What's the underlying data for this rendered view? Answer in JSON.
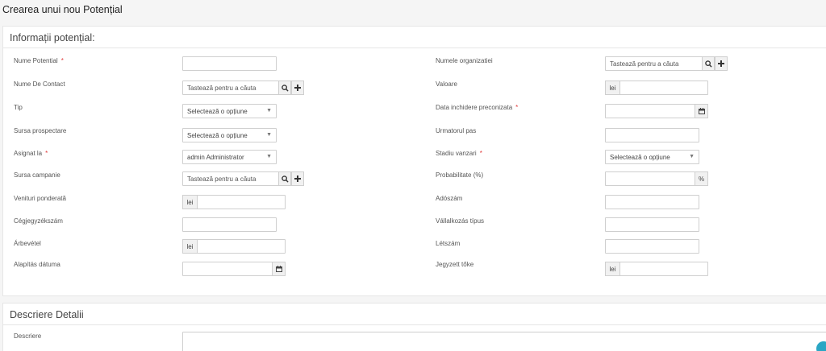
{
  "page": {
    "title": "Crearea unui nou Potențial"
  },
  "sections": {
    "info_title": "Informații potențial:",
    "desc_title": "Descriere Detalii"
  },
  "fields": {
    "nume_potential": {
      "label": "Nume Potential",
      "value": ""
    },
    "nume_contact": {
      "label": "Nume De Contact",
      "placeholder": "Tastează pentru a căuta"
    },
    "tip": {
      "label": "Tip",
      "selected": "Selectează o opțiune"
    },
    "sursa_prospectare": {
      "label": "Sursa prospectare",
      "selected": "Selectează o opțiune"
    },
    "asignat_la": {
      "label": "Asignat la",
      "selected": "admin Administrator"
    },
    "sursa_campanie": {
      "label": "Sursa campanie",
      "placeholder": "Tastează pentru a căuta"
    },
    "venituri_ponderata": {
      "label": "Venituri ponderată",
      "prefix": "lei"
    },
    "cegjegyzekszam": {
      "label": "Cégjegyzékszám"
    },
    "arbevetel": {
      "label": "Árbevétel",
      "prefix": "lei"
    },
    "alapitas_datuma": {
      "label": "Alapítás dátuma"
    },
    "numele_organizatiei": {
      "label": "Numele organizatiei",
      "placeholder": "Tastează pentru a căuta"
    },
    "valoare": {
      "label": "Valoare",
      "prefix": "lei"
    },
    "data_inchidere": {
      "label": "Data inchidere preconizata"
    },
    "urmatorul_pas": {
      "label": "Urmatorul pas"
    },
    "stadiu_vanzari": {
      "label": "Stadiu vanzari",
      "selected": "Selectează o opțiune"
    },
    "probabilitate": {
      "label": "Probabilitate (%)",
      "suffix": "%"
    },
    "adoszam": {
      "label": "Adószám"
    },
    "vallalkozas_tipus": {
      "label": "Vállalkozás típus"
    },
    "letszam": {
      "label": "Létszám"
    },
    "jegyzett_toke": {
      "label": "Jegyzett tőke",
      "prefix": "lei"
    },
    "descriere": {
      "label": "Descriere"
    }
  },
  "required_mark": "*",
  "caret": "▼",
  "icons": {
    "search": "search-icon",
    "plus": "plus-icon",
    "calendar": "calendar-icon"
  },
  "colors": {
    "required": "#e03a3a",
    "fab": "#2aa6c4"
  }
}
